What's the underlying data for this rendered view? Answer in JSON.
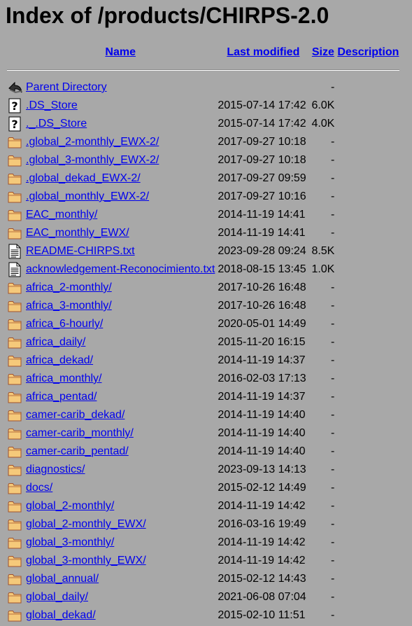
{
  "title": "Index of /products/CHIRPS-2.0",
  "columns": {
    "name": "Name",
    "last_modified": "Last modified",
    "size": "Size",
    "description": "Description"
  },
  "entries": [
    {
      "icon": "back-icon",
      "name": "Parent Directory",
      "date": "",
      "size": "-"
    },
    {
      "icon": "unknown-file-icon",
      "name": ".DS_Store",
      "date": "2015-07-14 17:42",
      "size": "6.0K"
    },
    {
      "icon": "unknown-file-icon",
      "name": "._.DS_Store",
      "date": "2015-07-14 17:42",
      "size": "4.0K"
    },
    {
      "icon": "folder-icon",
      "name": ".global_2-monthly_EWX-2/",
      "date": "2017-09-27 10:18",
      "size": "-"
    },
    {
      "icon": "folder-icon",
      "name": ".global_3-monthly_EWX-2/",
      "date": "2017-09-27 10:18",
      "size": "-"
    },
    {
      "icon": "folder-icon",
      "name": ".global_dekad_EWX-2/",
      "date": "2017-09-27 09:59",
      "size": "-"
    },
    {
      "icon": "folder-icon",
      "name": ".global_monthly_EWX-2/",
      "date": "2017-09-27 10:16",
      "size": "-"
    },
    {
      "icon": "folder-icon",
      "name": "EAC_monthly/",
      "date": "2014-11-19 14:41",
      "size": "-"
    },
    {
      "icon": "folder-icon",
      "name": "EAC_monthly_EWX/",
      "date": "2014-11-19 14:41",
      "size": "-"
    },
    {
      "icon": "text-file-icon",
      "name": "README-CHIRPS.txt",
      "date": "2023-09-28 09:24",
      "size": "8.5K"
    },
    {
      "icon": "text-file-icon",
      "name": "acknowledgement-Reconocimiento.txt",
      "date": "2018-08-15 13:45",
      "size": "1.0K"
    },
    {
      "icon": "folder-icon",
      "name": "africa_2-monthly/",
      "date": "2017-10-26 16:48",
      "size": "-"
    },
    {
      "icon": "folder-icon",
      "name": "africa_3-monthly/",
      "date": "2017-10-26 16:48",
      "size": "-"
    },
    {
      "icon": "folder-icon",
      "name": "africa_6-hourly/",
      "date": "2020-05-01 14:49",
      "size": "-"
    },
    {
      "icon": "folder-icon",
      "name": "africa_daily/",
      "date": "2015-11-20 16:15",
      "size": "-"
    },
    {
      "icon": "folder-icon",
      "name": "africa_dekad/",
      "date": "2014-11-19 14:37",
      "size": "-"
    },
    {
      "icon": "folder-icon",
      "name": "africa_monthly/",
      "date": "2016-02-03 17:13",
      "size": "-"
    },
    {
      "icon": "folder-icon",
      "name": "africa_pentad/",
      "date": "2014-11-19 14:37",
      "size": "-"
    },
    {
      "icon": "folder-icon",
      "name": "camer-carib_dekad/",
      "date": "2014-11-19 14:40",
      "size": "-"
    },
    {
      "icon": "folder-icon",
      "name": "camer-carib_monthly/",
      "date": "2014-11-19 14:40",
      "size": "-"
    },
    {
      "icon": "folder-icon",
      "name": "camer-carib_pentad/",
      "date": "2014-11-19 14:40",
      "size": "-"
    },
    {
      "icon": "folder-icon",
      "name": "diagnostics/",
      "date": "2023-09-13 14:13",
      "size": "-"
    },
    {
      "icon": "folder-icon",
      "name": "docs/",
      "date": "2015-02-12 14:49",
      "size": "-"
    },
    {
      "icon": "folder-icon",
      "name": "global_2-monthly/",
      "date": "2014-11-19 14:42",
      "size": "-"
    },
    {
      "icon": "folder-icon",
      "name": "global_2-monthly_EWX/",
      "date": "2016-03-16 19:49",
      "size": "-"
    },
    {
      "icon": "folder-icon",
      "name": "global_3-monthly/",
      "date": "2014-11-19 14:42",
      "size": "-"
    },
    {
      "icon": "folder-icon",
      "name": "global_3-monthly_EWX/",
      "date": "2014-11-19 14:42",
      "size": "-"
    },
    {
      "icon": "folder-icon",
      "name": "global_annual/",
      "date": "2015-02-12 14:43",
      "size": "-"
    },
    {
      "icon": "folder-icon",
      "name": "global_daily/",
      "date": "2021-06-08 07:04",
      "size": "-"
    },
    {
      "icon": "folder-icon",
      "name": "global_dekad/",
      "date": "2015-02-10 11:51",
      "size": "-"
    }
  ],
  "colors": {
    "background": "#a8a8a8",
    "link": "#0000ee",
    "folder_fill": "#f5c97a",
    "folder_stroke": "#a0522d"
  }
}
